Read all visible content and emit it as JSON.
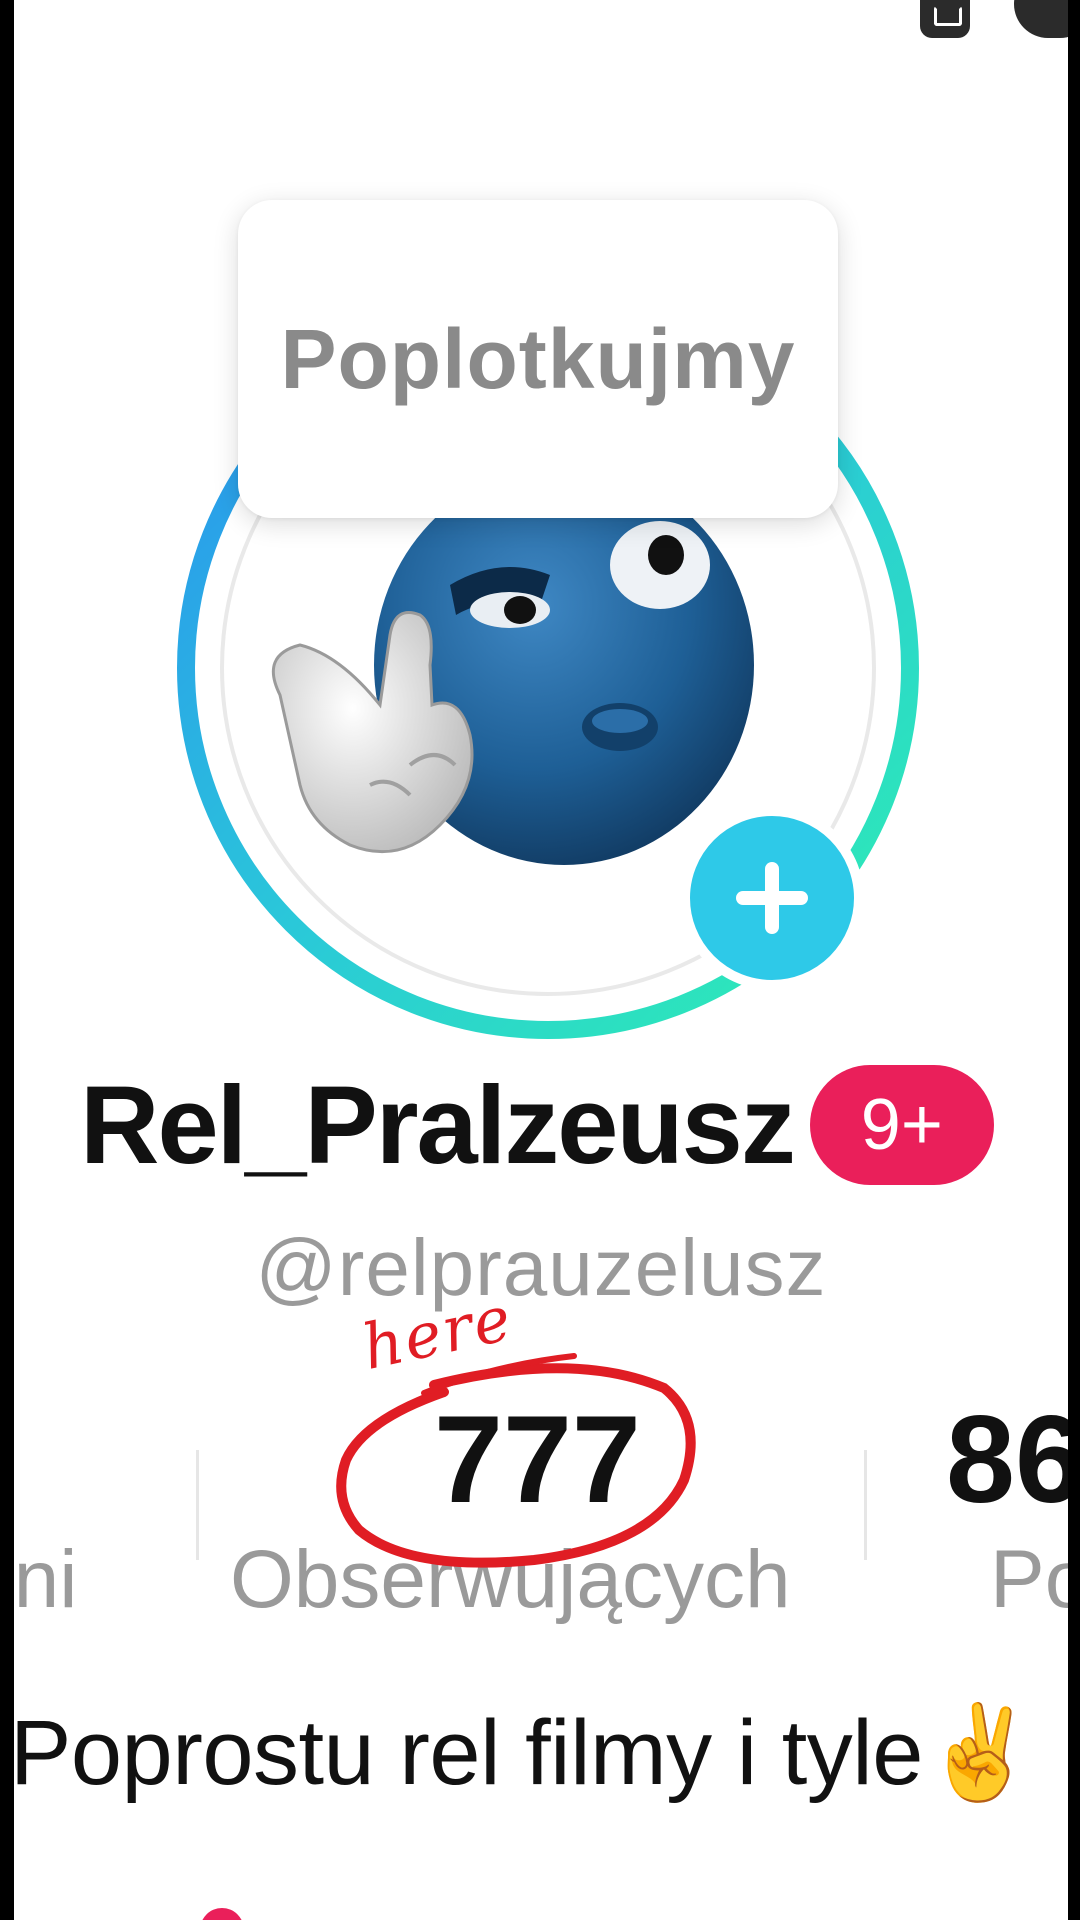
{
  "profile": {
    "note": "Poplotkujmy",
    "display_name": "Rel_Pralzeusz",
    "badge": "9+",
    "handle": "@relprauzelusz",
    "bio": "Poprostu rel filmy i tyle✌️"
  },
  "stats": {
    "left_label": "ani",
    "center_value": "777",
    "center_label": "Obserwujących",
    "right_value": "86",
    "right_label": "Po"
  },
  "annotation": {
    "text": "here",
    "color": "#e01d24"
  },
  "colors": {
    "ring_start": "#2aa0e6",
    "ring_end": "#2ee5b5",
    "plus_button": "#2ec9e8",
    "badge": "#ea1f5a"
  },
  "icons": [
    "expand-icon",
    "chat-icon",
    "plus-icon",
    "avatar-emoji"
  ]
}
